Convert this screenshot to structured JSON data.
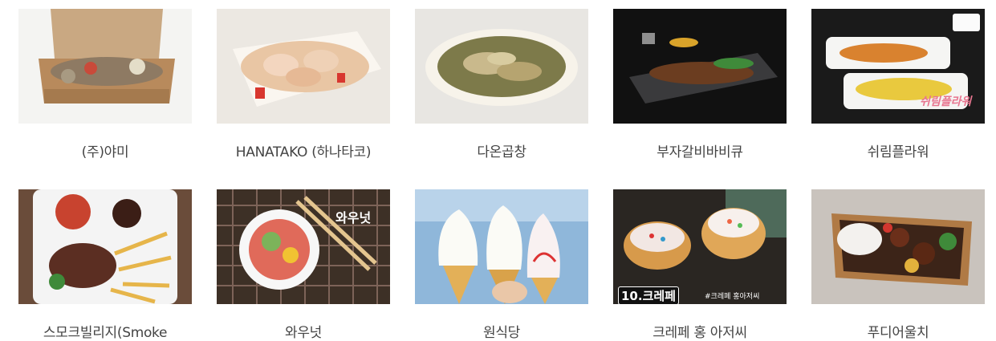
{
  "vendors": [
    {
      "name": "(주)야미",
      "image": "food-box-icon"
    },
    {
      "name": "HANATAKO (하나타코)",
      "image": "takoyaki-icon"
    },
    {
      "name": "다온곱창",
      "image": "gopchang-bowl-icon"
    },
    {
      "name": "부자갈비바비큐",
      "image": "galbi-plate-icon"
    },
    {
      "name": "쉬림플라워",
      "image": "shrimp-skewer-icon"
    },
    {
      "name": "스모크빌리지(Smoke",
      "image": "steak-fries-icon"
    },
    {
      "name": "와우넛",
      "image": "salad-bowl-icon"
    },
    {
      "name": "원식당",
      "image": "softserve-icon"
    },
    {
      "name": "크레페 홍 아저씨",
      "image": "crepe-icon"
    },
    {
      "name": "푸디어울치",
      "image": "steak-box-icon"
    }
  ],
  "overlays": {
    "shrimp_logo": "쉬림플라워",
    "wownut_logo": "와우넛",
    "crepe_badge": "10.크레페",
    "crepe_tag": "#크레페 홍아저씨"
  }
}
